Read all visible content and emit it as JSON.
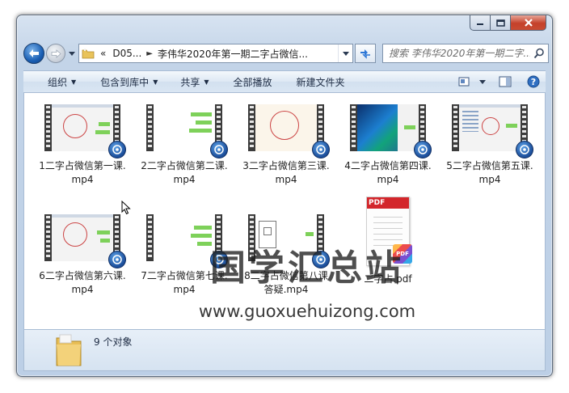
{
  "window": {
    "buttons": [
      "minimize",
      "maximize",
      "close"
    ]
  },
  "address": {
    "prefix": "«",
    "segments": [
      "D05...",
      "李伟华2020年第一期二字占微信..."
    ]
  },
  "search": {
    "placeholder": "搜索 李伟华2020年第一期二字..."
  },
  "toolbar": {
    "organize": "组织",
    "include_library": "包含到库中",
    "share": "共享",
    "play_all": "全部播放",
    "new_folder": "新建文件夹"
  },
  "files": [
    {
      "name": "1二字占微信第一课.mp4",
      "kind": "video"
    },
    {
      "name": "2二字占微信第二课.mp4",
      "kind": "video"
    },
    {
      "name": "3二字占微信第三课.mp4",
      "kind": "video"
    },
    {
      "name": "4二字占微信第四课.mp4",
      "kind": "video"
    },
    {
      "name": "5二字占微信第五课.mp4",
      "kind": "video"
    },
    {
      "name": "6二字占微信第六课.mp4",
      "kind": "video"
    },
    {
      "name": "7二字占微信第七课.mp4",
      "kind": "video"
    },
    {
      "name": "8二字占微信第八课答疑.mp4",
      "kind": "video"
    },
    {
      "name": "二字占.pdf",
      "kind": "pdf"
    }
  ],
  "pdf_labels": {
    "head": "PDF",
    "badge": "PDF"
  },
  "watermark": {
    "title": "国学汇总站",
    "url": "www.guoxuehuizong.com"
  },
  "details": {
    "count": "9 个对象"
  },
  "colors": {
    "accent": "#1a5fb4",
    "video_badge": "#1c4e9a",
    "close_red": "#c4412a",
    "pdf_red": "#d3262b"
  }
}
